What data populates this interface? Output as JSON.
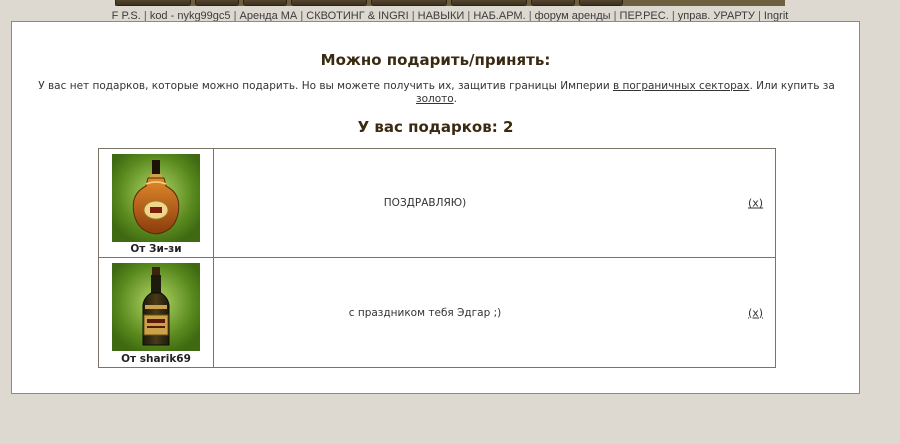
{
  "linkbar": {
    "items": [
      "F P.S.",
      "kod - nykg99gc5",
      "Аренда МА",
      "СКВОТИНГ & INGRI",
      "НАВЫКИ",
      "НАБ.АРМ.",
      "форум аренды",
      "ПЕР.РЕС.",
      "управ. УРАРТУ",
      "Ingrit"
    ]
  },
  "main": {
    "title": "Можно подарить/принять:",
    "info_before": "У вас нет подарков, которые можно подарить. Но вы можете получить их, защитив границы Империи ",
    "info_link1": "в пограничных секторах",
    "info_middle": ". Или купить за ",
    "info_link2": "золото",
    "info_after": ".",
    "gift_count": "У вас подарков: 2"
  },
  "gifts": [
    {
      "sender": "От Зи-зи",
      "message": "ПОЗДРАВЛЯЮ)",
      "delete_label": "(x)",
      "image_icon": "cognac-bottle-icon"
    },
    {
      "sender": "От sharik69",
      "message": "с праздником тебя Эдгар ;)",
      "delete_label": "(x)",
      "image_icon": "liqueur-bottle-icon"
    }
  ],
  "colors": {
    "page_bg": "#ddd9d0",
    "panel_bg": "#ffffff",
    "heading": "#3b2a12",
    "gift_bg": "#5a8a1e"
  }
}
